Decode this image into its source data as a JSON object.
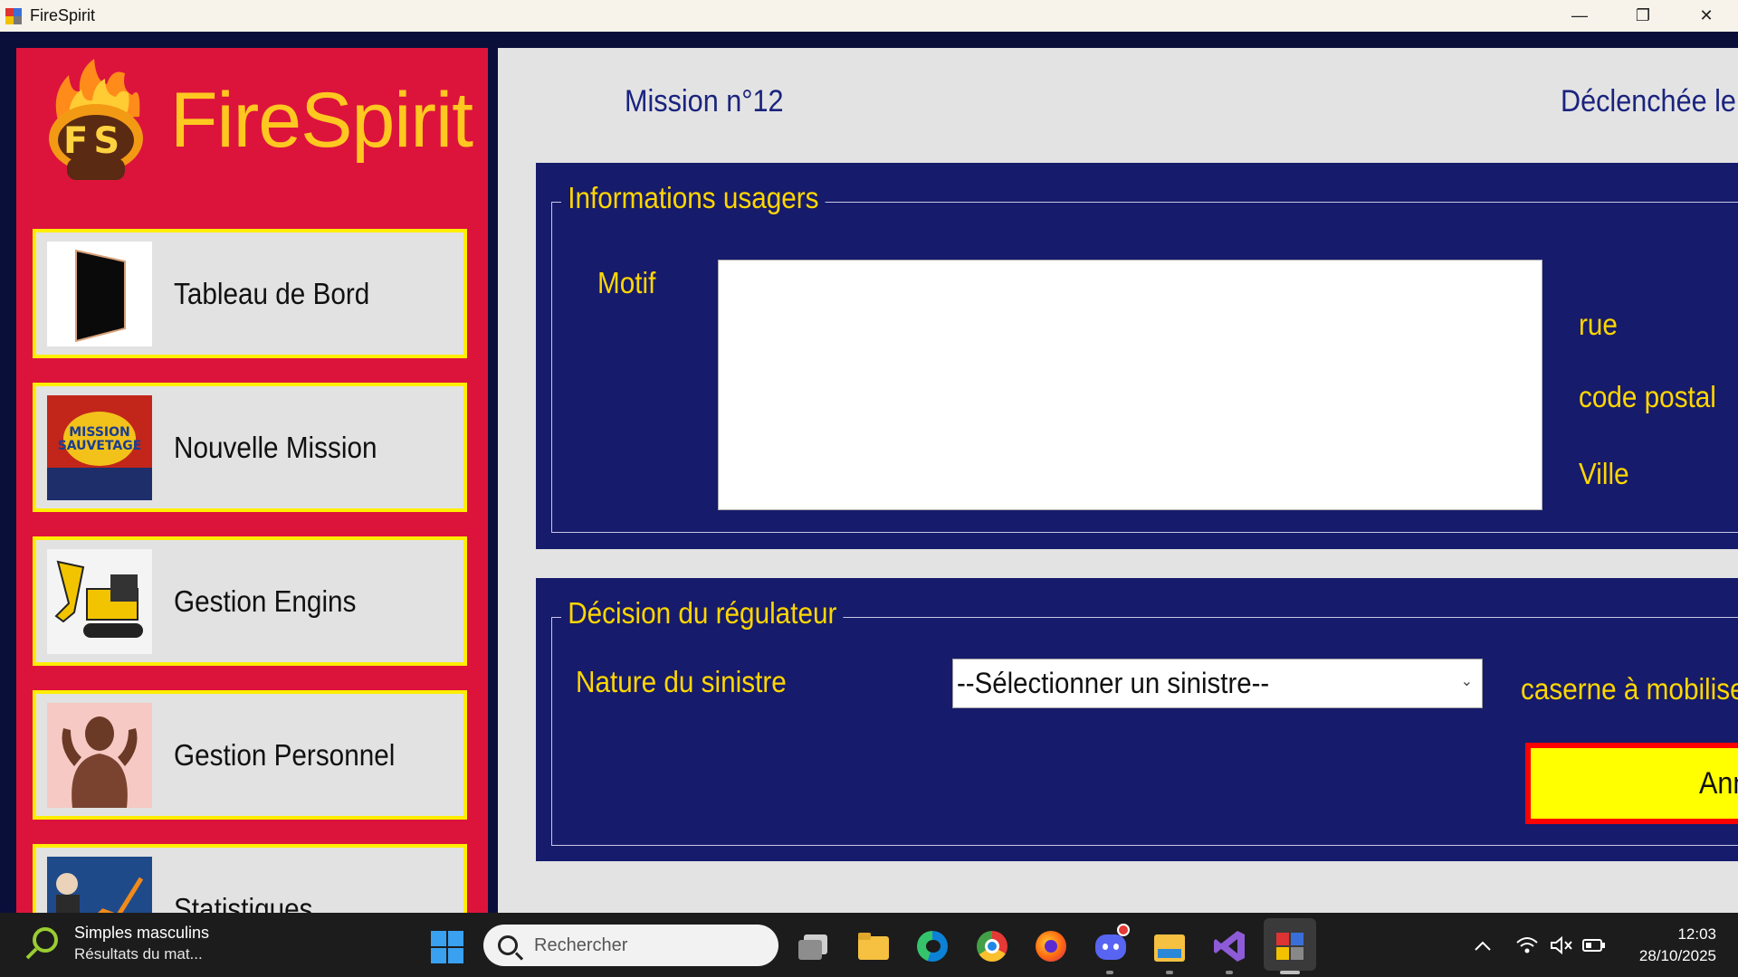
{
  "window": {
    "title": "FireSpirit",
    "minimize_glyph": "—",
    "restore_glyph": "❐",
    "close_glyph": "✕"
  },
  "sidebar": {
    "brand_name": "FireSpirit",
    "logo_text": "FS",
    "items": [
      {
        "label": "Tableau de Bord",
        "icon": "dashboard-icon"
      },
      {
        "label": "Nouvelle Mission",
        "icon": "mission-sauvetage-image"
      },
      {
        "label": "Gestion Engins",
        "icon": "excavator-image"
      },
      {
        "label": "Gestion Personnel",
        "icon": "person-image"
      },
      {
        "label": "Statistiques",
        "icon": "stock-chart-image"
      }
    ],
    "thumb_texts": {
      "mission_line1": "MISSION",
      "mission_line2": "SAUVETAGE"
    }
  },
  "main": {
    "mission_title": "Mission n°12",
    "declenchee_label": "Déclenchée le:",
    "info_group": {
      "legend": "Informations usagers",
      "motif_label": "Motif",
      "motif_value": "",
      "rue_label": "rue",
      "code_postal_label": "code postal",
      "ville_label": "Ville"
    },
    "decision_group": {
      "legend": "Décision du régulateur",
      "nature_label": "Nature du sinistre",
      "nature_selected": "--Sélectionner un sinistre--",
      "caserne_label": "caserne à mobiliser",
      "cancel_label": "Annuler"
    }
  },
  "taskbar": {
    "weather_title": "Simples masculins",
    "weather_sub": "Résultats du mat...",
    "search_placeholder": "Rechercher",
    "time": "12:03",
    "date": "28/10/2025"
  },
  "colors": {
    "sidebar_bg": "#dc143c",
    "brand": "#ffc820",
    "panel_bg": "#171b6b",
    "label_yellow": "#ffd700",
    "nav_border": "#ffee00",
    "cancel_bg": "#ffff00",
    "cancel_border": "#ff0000"
  }
}
